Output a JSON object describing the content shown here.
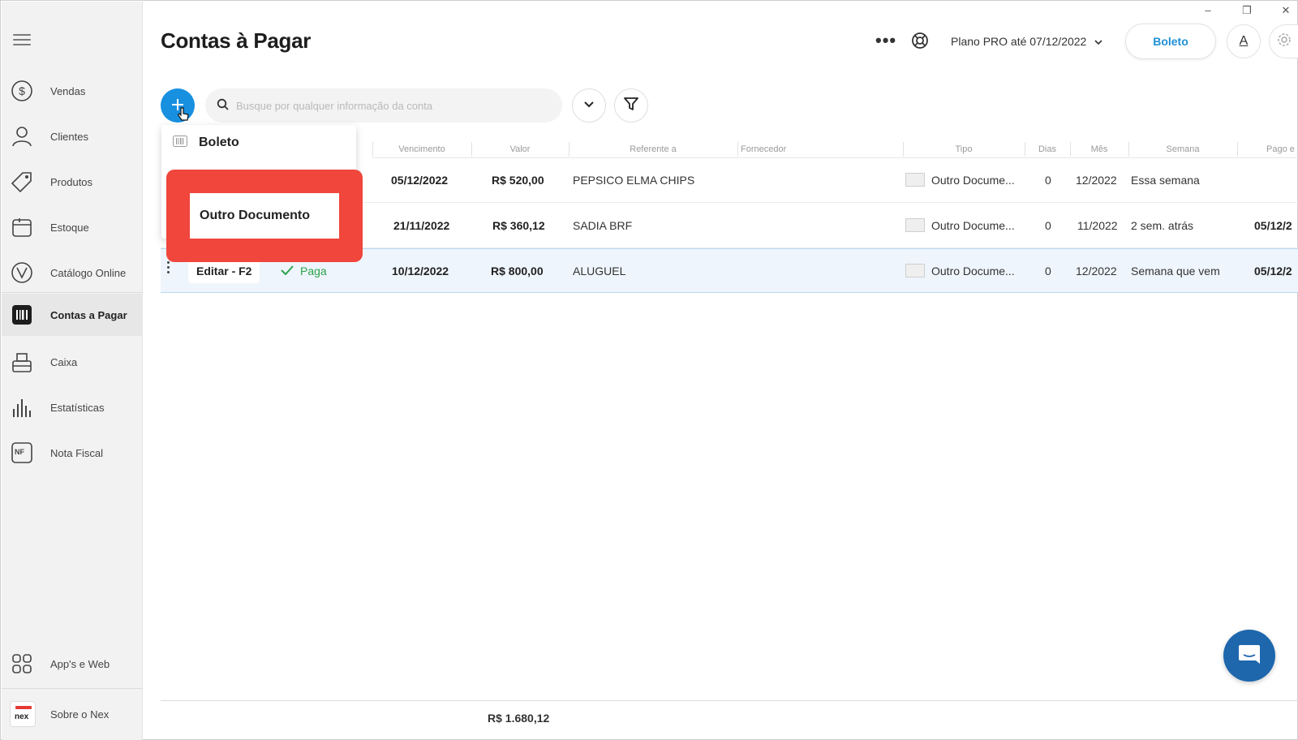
{
  "window": {
    "minimize": "–",
    "restore": "❐",
    "close": "✕"
  },
  "sidebar": {
    "items": [
      {
        "label": "Vendas",
        "icon": "dollar-circle-icon"
      },
      {
        "label": "Clientes",
        "icon": "user-icon"
      },
      {
        "label": "Produtos",
        "icon": "tag-icon"
      },
      {
        "label": "Estoque",
        "icon": "box-icon"
      },
      {
        "label": "Catálogo Online",
        "icon": "catalog-icon"
      },
      {
        "label": "Contas a Pagar",
        "icon": "barcode-icon",
        "active": true
      },
      {
        "label": "Caixa",
        "icon": "cash-register-icon"
      },
      {
        "label": "Estatísticas",
        "icon": "bar-chart-icon"
      },
      {
        "label": "Nota Fiscal",
        "icon": "nf-icon",
        "badge": "NF"
      }
    ],
    "bottom_items": [
      {
        "label": "App's e Web",
        "icon": "apps-grid-icon"
      },
      {
        "label": "Sobre o Nex",
        "icon": "nex-logo-icon",
        "logo_text": "nex"
      }
    ]
  },
  "header": {
    "title": "Contas à Pagar",
    "more": "•••",
    "plan": "Plano PRO até 07/12/2022",
    "boleto_button": "Boleto",
    "avatar_letter": "A"
  },
  "toolbar": {
    "search_placeholder": "Busque por qualquer informação da conta"
  },
  "dropdown": {
    "items": [
      {
        "label": "Boleto",
        "icon": "barcode-small-icon"
      },
      {
        "label": "Outro Documento",
        "highlighted": true
      }
    ]
  },
  "table": {
    "columns": [
      "Vencimento",
      "Valor",
      "Referente a",
      "Fornecedor",
      "Tipo",
      "Dias",
      "Mês",
      "Semana",
      "Pago e"
    ],
    "rows": [
      {
        "vencimento": "05/12/2022",
        "valor": "R$ 520,00",
        "referente": "PEPSICO ELMA CHIPS",
        "tipo": "Outro Docume...",
        "dias": "0",
        "mes": "12/2022",
        "semana": "Essa semana",
        "pago": ""
      },
      {
        "vencimento": "21/11/2022",
        "valor": "R$ 360,12",
        "referente": "SADIA BRF",
        "tipo": "Outro Docume...",
        "dias": "0",
        "mes": "11/2022",
        "semana": "2 sem. atrás",
        "pago": "05/12/2"
      },
      {
        "edit": "Editar - F2",
        "status": "Paga",
        "vencimento": "10/12/2022",
        "valor": "R$ 800,00",
        "referente": "ALUGUEL",
        "tipo": "Outro Docume...",
        "dias": "0",
        "mes": "12/2022",
        "semana": "Semana que vem",
        "pago": "05/12/2",
        "selected": true
      }
    ]
  },
  "footer": {
    "total": "R$ 1.680,12"
  },
  "colors": {
    "accent": "#1890e0",
    "highlight": "#f0463c",
    "paid_green": "#2ba34a",
    "chat": "#1e67ad"
  }
}
